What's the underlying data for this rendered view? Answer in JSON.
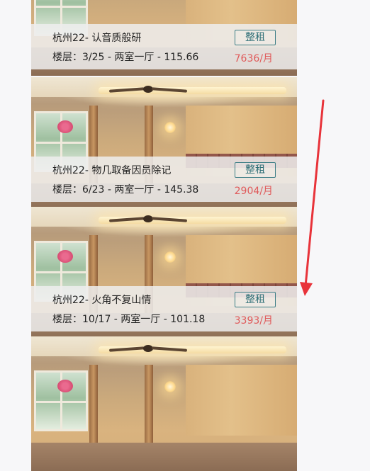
{
  "listings": [
    {
      "title": "杭州22- 认音质般研",
      "meta": "楼层：3/25 - 两室一厅 - 115.66",
      "tag": "整租",
      "price": "7636/月"
    },
    {
      "title": "杭州22- 物几取备因员除记",
      "meta": "楼层：6/23 - 两室一厅 - 145.38",
      "tag": "整租",
      "price": "2904/月"
    },
    {
      "title": "杭州22- 火角不复山情",
      "meta": "楼层：10/17 - 两室一厅 - 101.18",
      "tag": "整租",
      "price": "3393/月"
    },
    {
      "title": "",
      "meta": "",
      "tag": "",
      "price": ""
    }
  ],
  "annotation": {
    "arrow_color": "#e8333a",
    "arrow_meaning": "scroll-down-indicator"
  },
  "colors": {
    "tag_border": "#3d7e86",
    "price": "#e05a5a",
    "overlay": "rgba(238,238,238,0.86)"
  }
}
